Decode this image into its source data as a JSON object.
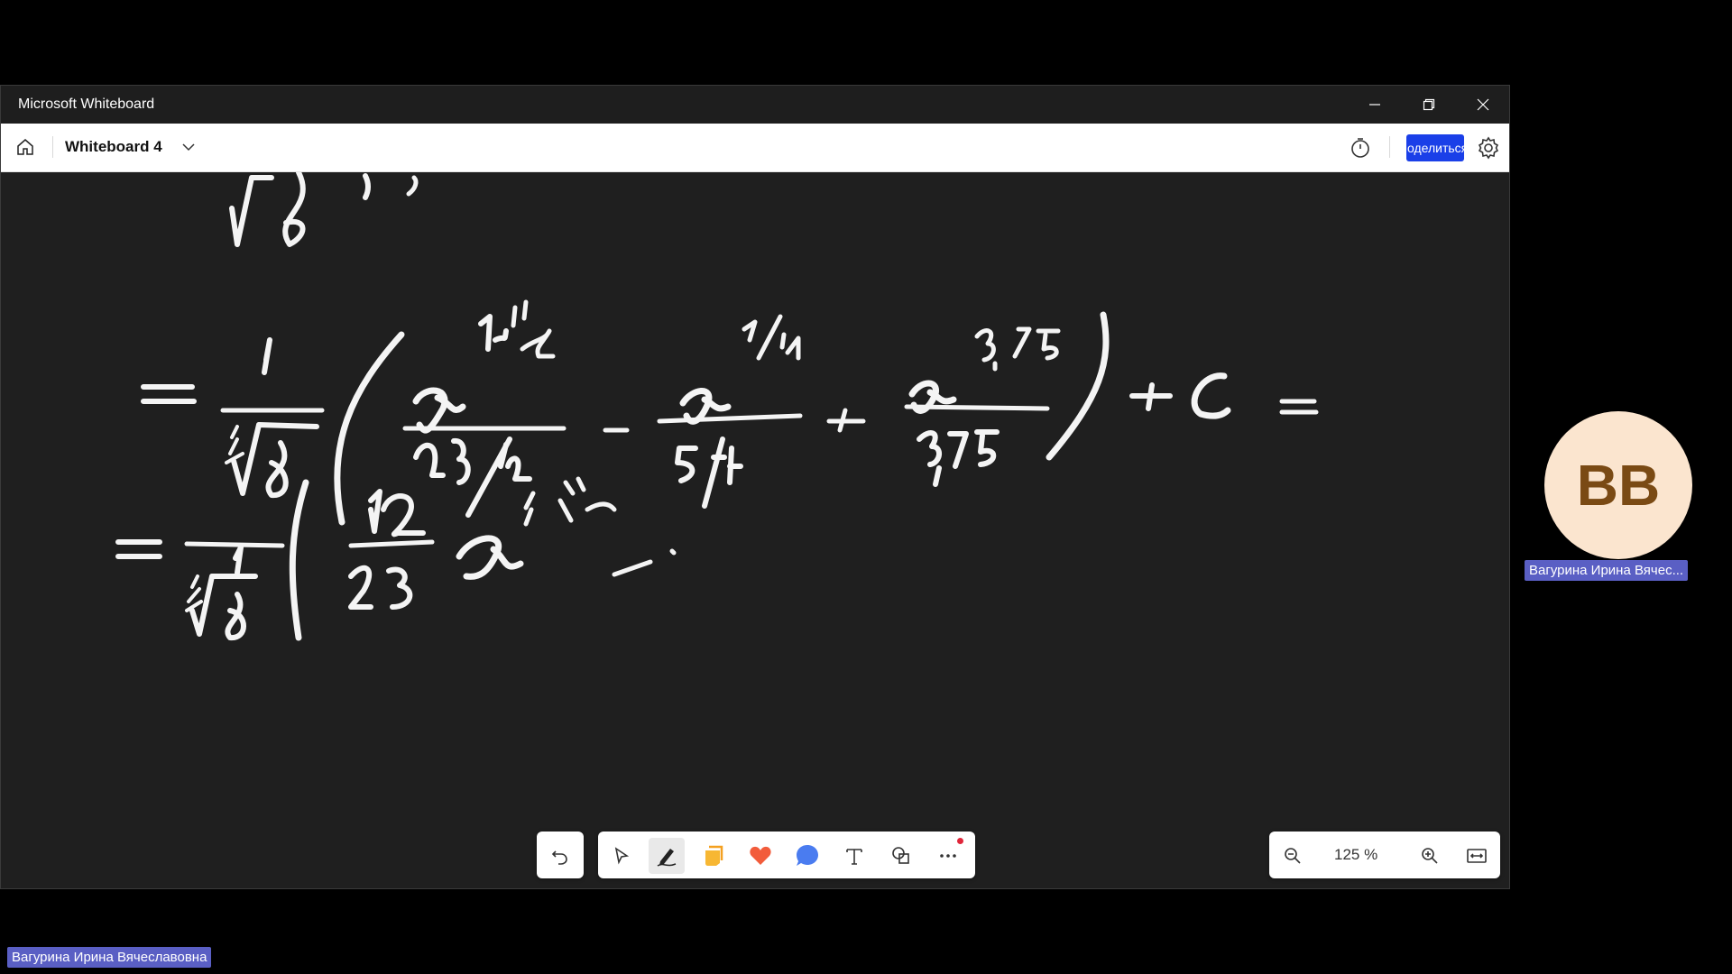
{
  "window": {
    "title": "Microsoft Whiteboard",
    "controls": [
      "minimize-icon",
      "restore-icon",
      "close-icon"
    ]
  },
  "appbar": {
    "board_title": "Whiteboard 4",
    "share_label": "оделиться",
    "icons": [
      "home-icon",
      "chevron-down-icon",
      "timer-icon",
      "gear-icon"
    ]
  },
  "toolbar": {
    "tools": [
      "undo-icon",
      "select-icon",
      "pen-icon",
      "sticky-note-icon",
      "reaction-icon",
      "comment-icon",
      "text-icon",
      "shapes-icon",
      "more-icon"
    ],
    "active_tool": "pen",
    "more_has_badge": true
  },
  "zoom": {
    "level": "125 %",
    "icons": [
      "zoom-out-icon",
      "zoom-in-icon",
      "fit-to-screen-icon"
    ]
  },
  "participant": {
    "initials": "BB",
    "name_truncated": "Вагурина Ирина Вячес...",
    "full_name": "Вагурина Ирина Вячеславовна"
  },
  "colors": {
    "canvas": "#1f1f1f",
    "ink": "#f4f4f4",
    "share_button": "#1a3fe8",
    "name_chip": "#5a5fc4",
    "avatar_bg": "#fbe5cf",
    "avatar_fg": "#7a4a14"
  }
}
